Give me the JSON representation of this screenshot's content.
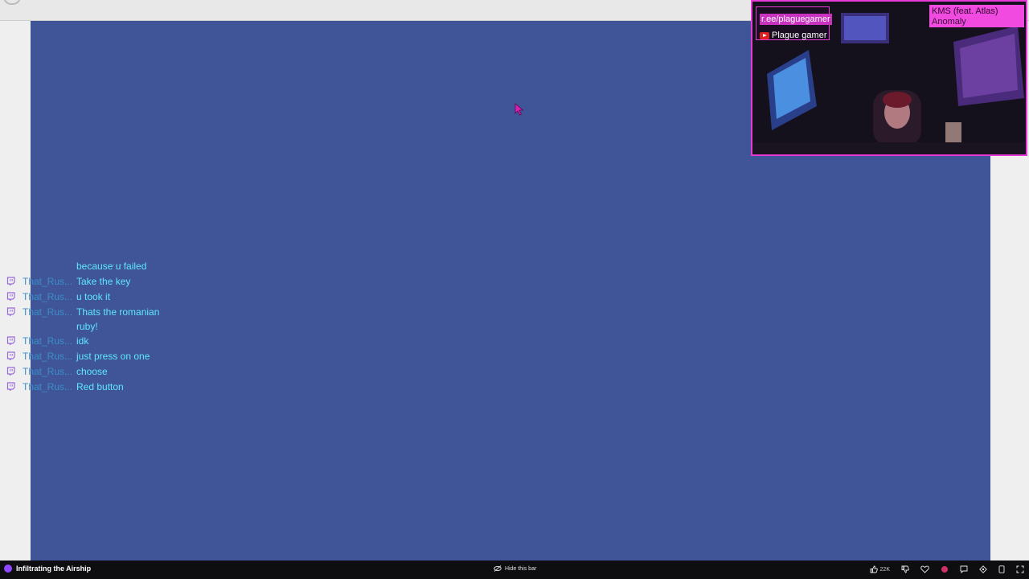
{
  "webcam": {
    "link_text": "r.ee/plaguegamer",
    "youtube_text": "Plague gamer",
    "now_playing": {
      "title": "KMS (feat. Atlas)",
      "artist": "Anomaly"
    },
    "border_color": "#e83ad6"
  },
  "game": {
    "background_color": "#3f5597"
  },
  "chat": {
    "dots": ". .",
    "messages": [
      {
        "user": "",
        "text": "because u failed",
        "show_meta": false
      },
      {
        "user": "That_Rus...",
        "text": "Take the key",
        "show_meta": true
      },
      {
        "user": "That_Rus...",
        "text": "u took it",
        "show_meta": true
      },
      {
        "user": "That_Rus...",
        "text": "Thats the romanian ruby!",
        "show_meta": true
      },
      {
        "user": "That_Rus...",
        "text": "idk",
        "show_meta": true
      },
      {
        "user": "That_Rus...",
        "text": "just press on one",
        "show_meta": true
      },
      {
        "user": "That_Rus...",
        "text": "choose",
        "show_meta": true
      },
      {
        "user": "That_Rus...",
        "text": "Red button",
        "show_meta": true
      }
    ],
    "platform_icon": "twitch-icon",
    "name_color": "#3c8ec9",
    "message_color": "#5ee8ff"
  },
  "bottom_bar": {
    "title": "Infiltrating the Airship",
    "hide_label": "Hide this bar",
    "like_count": "22K",
    "accent_color": "#9147ff"
  }
}
